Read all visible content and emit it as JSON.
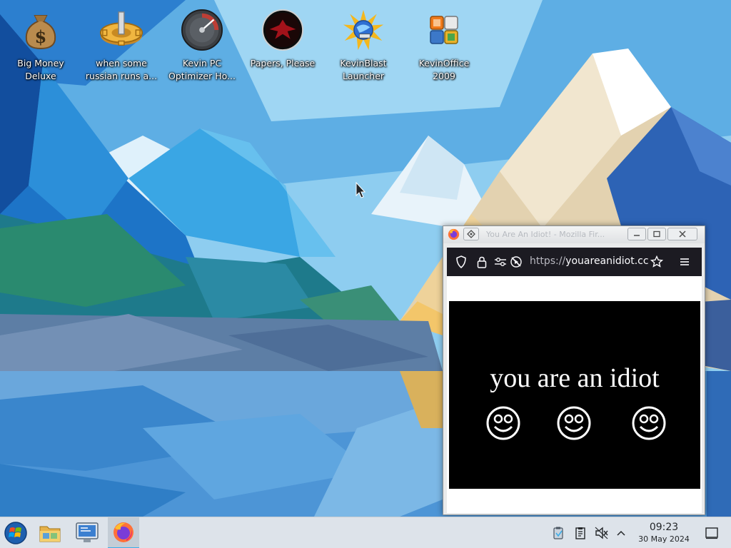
{
  "desktop": {
    "icons": [
      {
        "label": "Big Money\nDeluxe",
        "icon": "money-bag-icon"
      },
      {
        "label": "when some\nrussian runs a...",
        "icon": "gear-icon"
      },
      {
        "label": "Kevin PC\nOptimizer Ho...",
        "icon": "speedometer-icon"
      },
      {
        "label": "Papers, Please",
        "icon": "eagle-emblem-icon"
      },
      {
        "label": "KevinBlast\nLauncher",
        "icon": "sunburst-globe-icon"
      },
      {
        "label": "KevinOffice\n2009",
        "icon": "office-logo-icon"
      }
    ]
  },
  "browser": {
    "title": "You Are An Idiot! - Mozilla Fir...",
    "url_scheme": "https://",
    "url_host": "youareanidiot.cc",
    "page": {
      "headline": "you are an idiot",
      "smiley_count": 3
    }
  },
  "taskbar": {
    "clock_time": "09:23",
    "clock_date": "30 May 2024",
    "apps": [
      "start-menu",
      "file-manager",
      "system-settings",
      "firefox"
    ]
  },
  "colors": {
    "accent": "#3daee9",
    "taskbar_bg": "#dde3ea",
    "browser_toolbar": "#1c1b22",
    "page_black": "#000000"
  }
}
